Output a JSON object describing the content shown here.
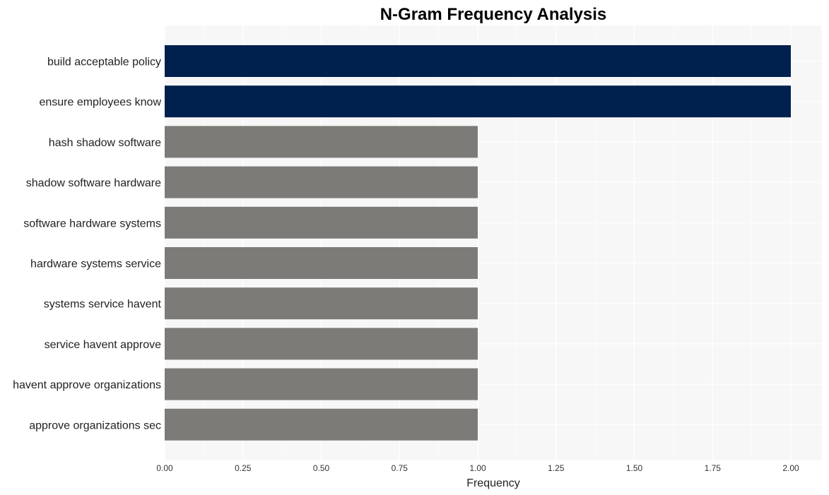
{
  "chart_data": {
    "type": "bar",
    "orientation": "horizontal",
    "title": "N-Gram Frequency Analysis",
    "xlabel": "Frequency",
    "ylabel": "",
    "categories": [
      "build acceptable policy",
      "ensure employees know",
      "hash shadow software",
      "shadow software hardware",
      "software hardware systems",
      "hardware systems service",
      "systems service havent",
      "service havent approve",
      "havent approve organizations",
      "approve organizations sec"
    ],
    "values": [
      2,
      2,
      1,
      1,
      1,
      1,
      1,
      1,
      1,
      1
    ],
    "xlim": [
      0,
      2.1
    ],
    "xticks": [
      "0.00",
      "0.25",
      "0.50",
      "0.75",
      "1.00",
      "1.25",
      "1.50",
      "1.75",
      "2.00"
    ],
    "xtick_values": [
      0,
      0.25,
      0.5,
      0.75,
      1.0,
      1.25,
      1.5,
      1.75,
      2.0
    ],
    "grid": true,
    "colors": {
      "highlight": "#00204e",
      "default": "#7c7b77",
      "panel_background": "#f7f7f7",
      "gridline": "#ffffff"
    },
    "highlight_rule": "max value"
  }
}
